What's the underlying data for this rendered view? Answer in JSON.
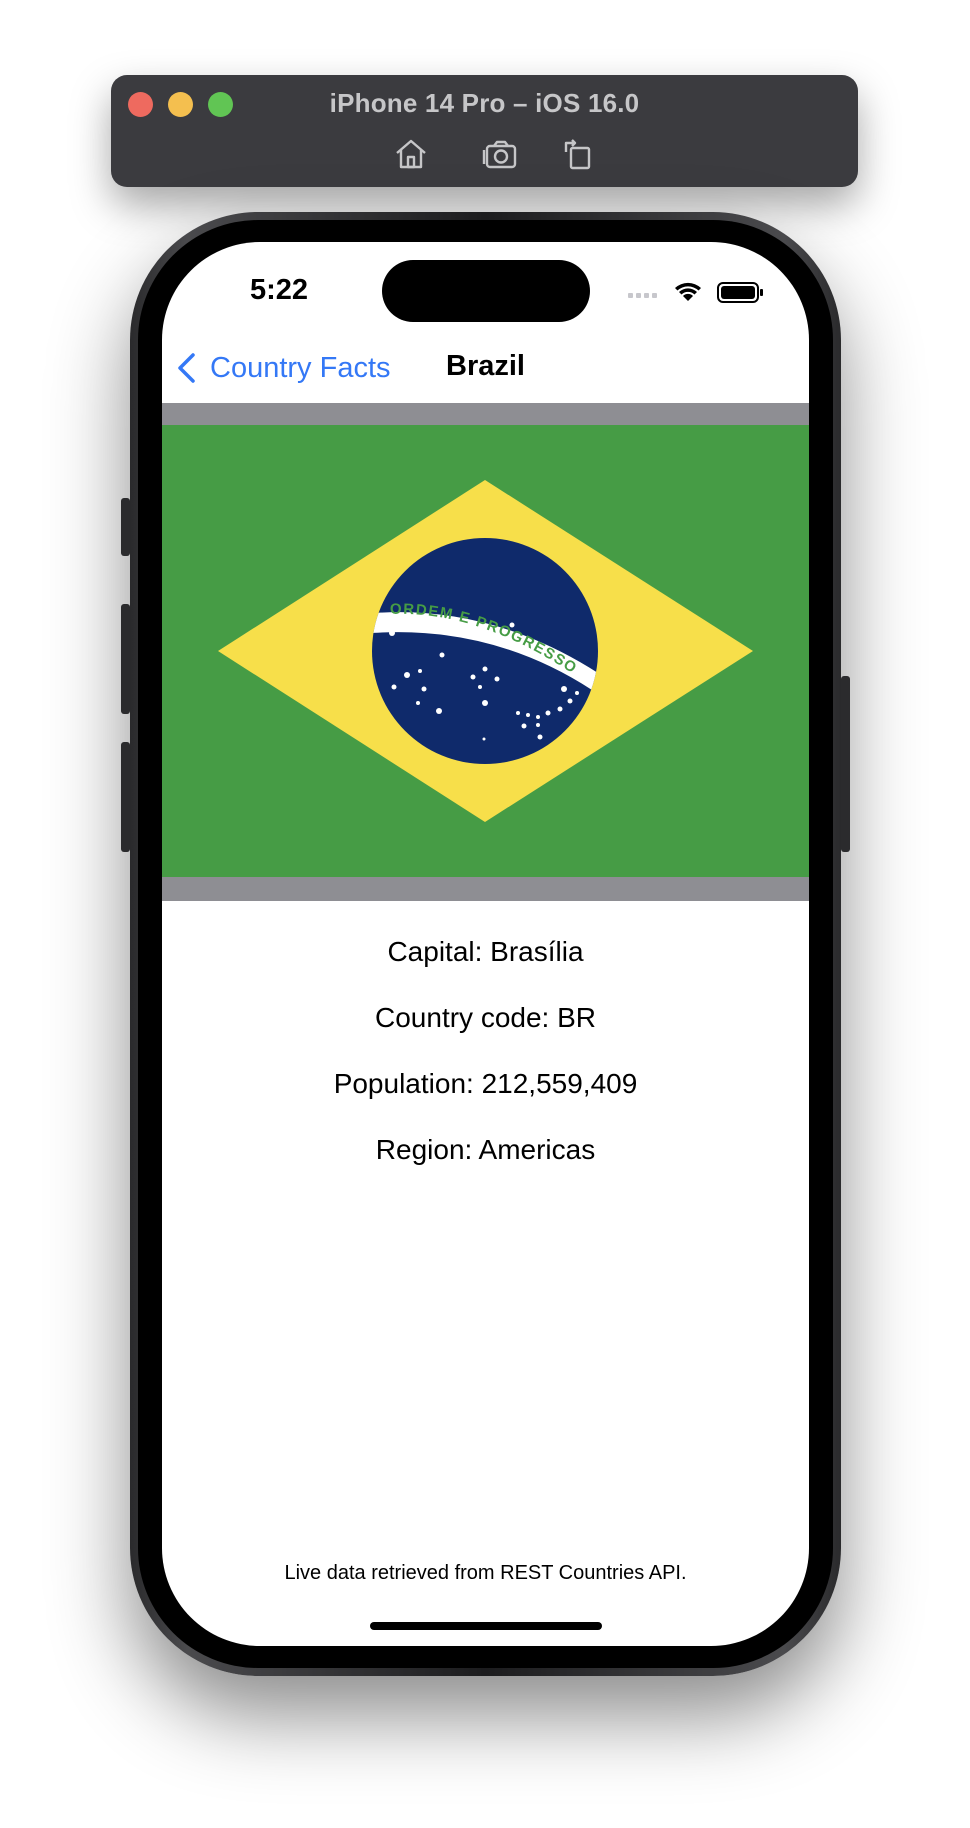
{
  "simulator": {
    "title": "iPhone 14 Pro – iOS 16.0",
    "toolbar_icons": [
      "home-icon",
      "screenshot-icon",
      "rotate-icon"
    ]
  },
  "status_bar": {
    "time": "5:22"
  },
  "nav": {
    "back_label": "Country Facts",
    "title": "Brazil"
  },
  "flag": {
    "banner_text": "ORDEM E PROGRESSO",
    "colors": {
      "green": "#469c45",
      "yellow": "#f7df4a",
      "blue": "#0f2a6b",
      "white": "#ffffff",
      "band_text": "#469c45"
    }
  },
  "facts": [
    {
      "label": "Capital: Brasília"
    },
    {
      "label": "Country code: BR"
    },
    {
      "label": "Population: 212,559,409"
    },
    {
      "label": "Region: Americas"
    }
  ],
  "footer": "Live data retrieved from REST Countries API.",
  "colors": {
    "accent": "#3478f6",
    "letterbox": "#8e8e93"
  }
}
